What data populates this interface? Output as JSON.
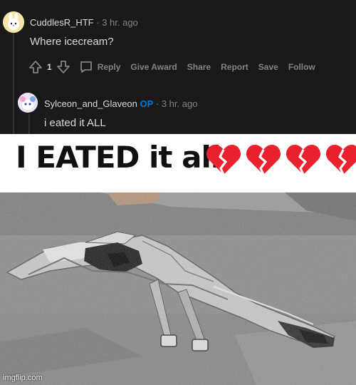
{
  "comment1": {
    "username": "CuddlesR_HTF",
    "separator": "·",
    "time": "3 hr. ago",
    "body": "Where icecream?",
    "vote_count": "1",
    "actions": [
      "Reply",
      "Give Award",
      "Share",
      "Report",
      "Save",
      "Follow"
    ]
  },
  "comment2": {
    "username": "Sylceon_and_Glaveon",
    "op_badge": "OP",
    "separator": "·",
    "time": "3 hr. ago",
    "body": "i eated it ALL"
  },
  "meme": {
    "caption": "I EATED it all",
    "hearts": [
      "broken-heart-icon",
      "broken-heart-icon",
      "broken-heart-icon",
      "broken-heart-icon"
    ],
    "heart_color": "#e8212d",
    "watermark": "imgflip.com"
  },
  "colors": {
    "background": "#1a1a1b",
    "text": "#d7dadc",
    "muted": "#818384",
    "op": "#0079d3"
  }
}
